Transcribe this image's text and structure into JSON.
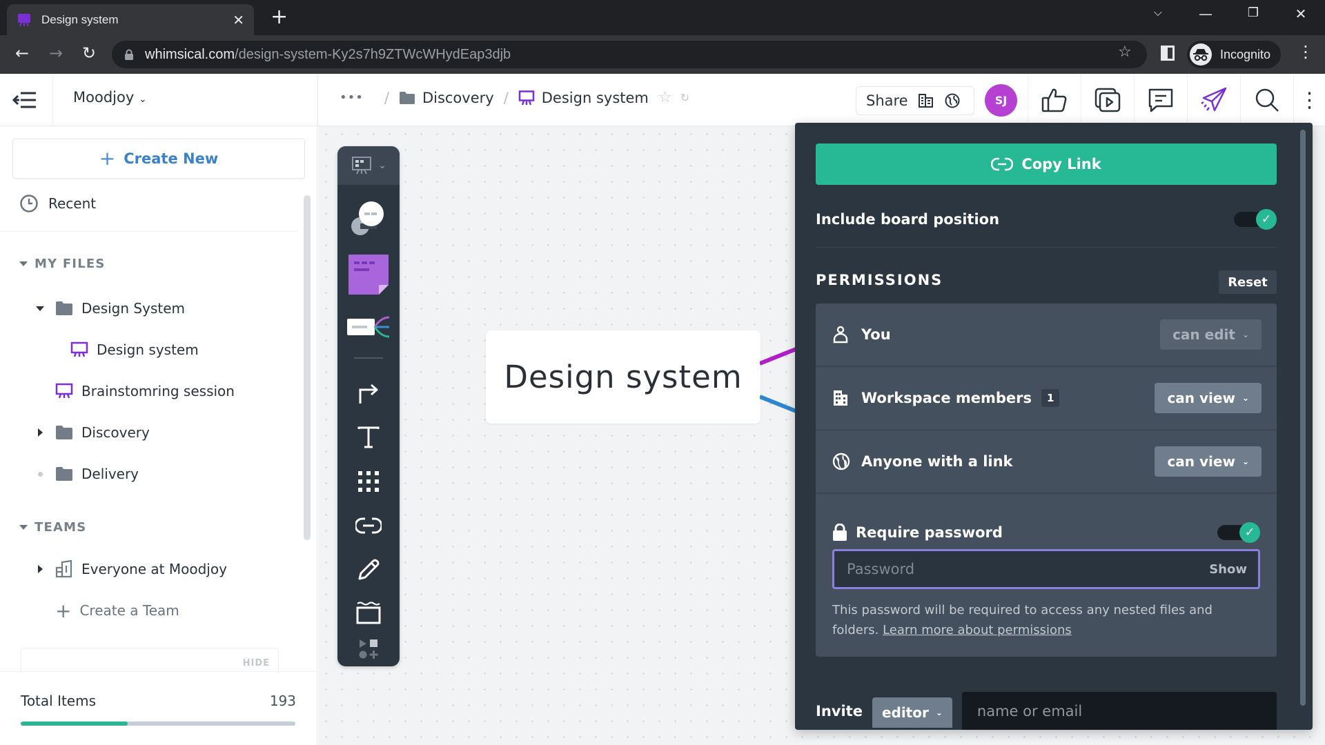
{
  "browser": {
    "tab_title": "Design system",
    "url_host": "whimsical.com",
    "url_path": "/design-system-Ky2s7h9ZTWcWHydEap3djb",
    "profile_label": "Incognito"
  },
  "header": {
    "workspace": "Moodjoy",
    "breadcrumb": {
      "more": "•••",
      "folder": "Discovery",
      "current": "Design system"
    },
    "share_label": "Share",
    "avatar_initials": "SJ",
    "colors": {
      "avatar": "#b640d1",
      "accent_purple": "#7b2fd6"
    }
  },
  "sidebar": {
    "create_new": "Create New",
    "recent": "Recent",
    "my_files_header": "MY FILES",
    "my_files": [
      {
        "label": "Design System",
        "type": "folder",
        "state": "expanded"
      },
      {
        "label": "Design system",
        "type": "board",
        "state": "child"
      },
      {
        "label": "Brainstomring session",
        "type": "board",
        "state": "leaf"
      },
      {
        "label": "Discovery",
        "type": "folder",
        "state": "collapsed"
      },
      {
        "label": "Delivery",
        "type": "folder",
        "state": "empty"
      }
    ],
    "teams_header": "TEAMS",
    "teams": [
      {
        "label": "Everyone at Moodjoy",
        "type": "team",
        "state": "collapsed"
      }
    ],
    "create_team": "Create a Team",
    "hide_label": "HIDE",
    "total_items_label": "Total Items",
    "total_items_value": "193",
    "total_items_progress": 0.39,
    "colors": {
      "progress": "#2bb594",
      "link": "#3b82c6"
    }
  },
  "canvas": {
    "board_title": "Design system",
    "toolbar_tools": [
      "board-switcher",
      "comment-bubble",
      "sticky-note",
      "mind-map",
      "connector",
      "text",
      "grid",
      "link",
      "pen",
      "frame",
      "more-shapes"
    ]
  },
  "share_panel": {
    "copy_link": "Copy Link",
    "include_board_position": "Include board position",
    "include_board_position_on": true,
    "permissions_title": "PERMISSIONS",
    "reset": "Reset",
    "rows": [
      {
        "label": "You",
        "value": "can edit",
        "badge": null,
        "disabled": true
      },
      {
        "label": "Workspace members",
        "value": "can view",
        "badge": "1",
        "disabled": false
      },
      {
        "label": "Anyone with a link",
        "value": "can view",
        "badge": null,
        "disabled": false
      }
    ],
    "require_password": "Require password",
    "require_password_on": true,
    "password_placeholder": "Password",
    "password_value": "",
    "show": "Show",
    "help_text": "This password will be required to access any nested files and folders.",
    "help_link": "Learn more about permissions",
    "invite_label": "Invite",
    "invite_role": "editor",
    "invite_placeholder": "name or email",
    "colors": {
      "primary": "#27b995",
      "panel": "#2c3641",
      "focus": "#8b7fe0"
    }
  }
}
